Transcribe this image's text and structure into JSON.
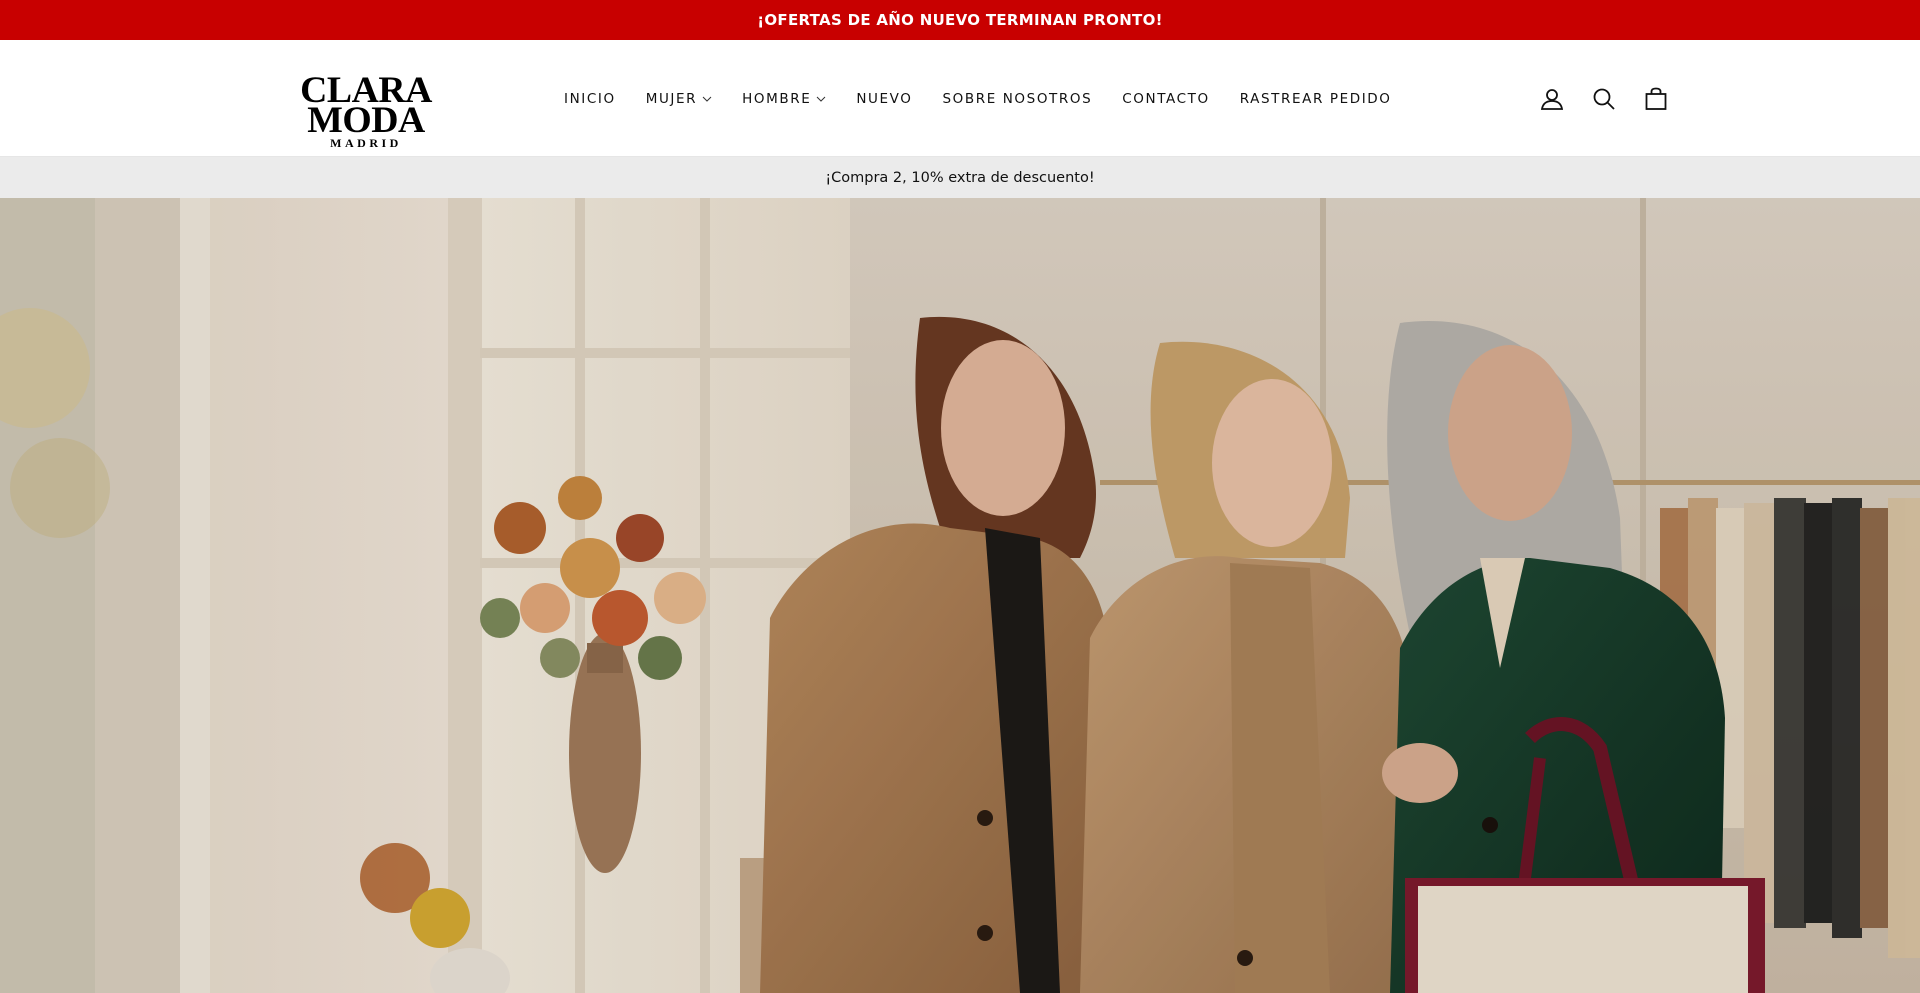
{
  "announcement": {
    "text": "¡OFERTAS DE AÑO NUEVO TERMINAN PRONTO!"
  },
  "brand": {
    "name": "CLARA MODA",
    "city": "MADRID"
  },
  "nav": {
    "items": [
      {
        "label": "INICIO",
        "has_dropdown": false
      },
      {
        "label": "MUJER",
        "has_dropdown": true
      },
      {
        "label": "HOMBRE",
        "has_dropdown": true
      },
      {
        "label": "NUEVO",
        "has_dropdown": false
      },
      {
        "label": "SOBRE NOSOTROS",
        "has_dropdown": false
      },
      {
        "label": "CONTACTO",
        "has_dropdown": false
      },
      {
        "label": "RASTREAR PEDIDO",
        "has_dropdown": false
      }
    ]
  },
  "header_icons": [
    "account-icon",
    "search-icon",
    "cart-icon"
  ],
  "promo_bar": {
    "text": "¡Compra 2, 10% extra de descuento!"
  },
  "colors": {
    "announcement_bg": "#c80000",
    "promo_bg": "#ebebeb",
    "text": "#111111"
  }
}
